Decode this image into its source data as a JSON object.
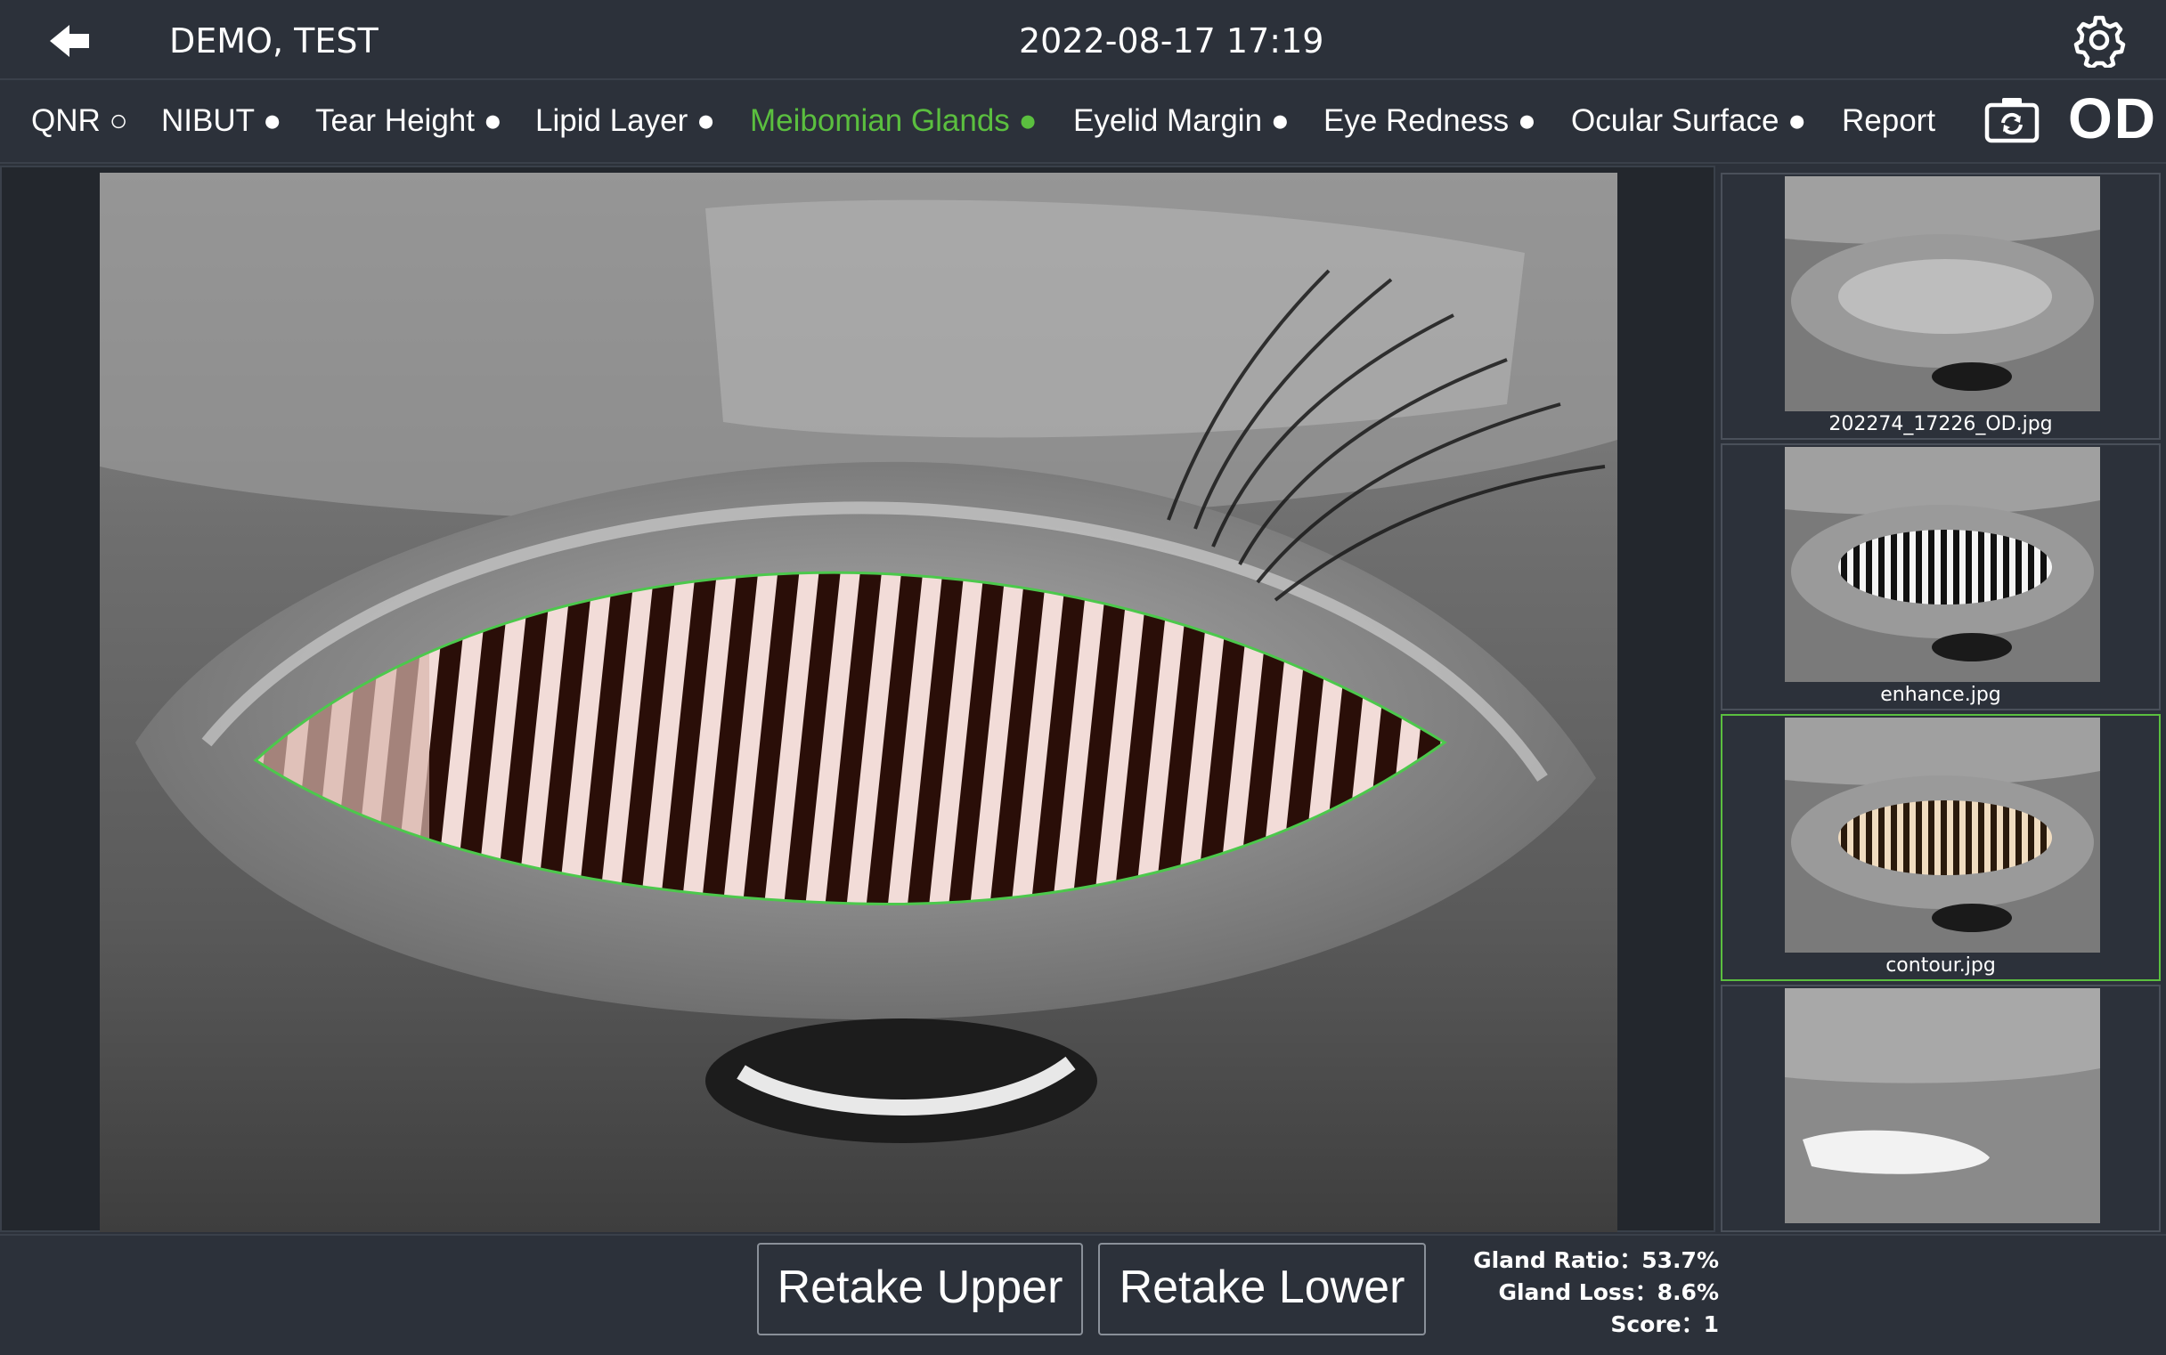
{
  "header": {
    "patient_name": "DEMO, TEST",
    "datetime": "2022-08-17 17:19"
  },
  "nav": {
    "tabs": [
      {
        "label": "QNR ○"
      },
      {
        "label": "NIBUT ●"
      },
      {
        "label": "Tear Height ●"
      },
      {
        "label": "Lipid Layer ●"
      },
      {
        "label": "Meibomian Glands ●",
        "active": true
      },
      {
        "label": "Eyelid Margin ●"
      },
      {
        "label": "Eye Redness ●"
      },
      {
        "label": "Ocular Surface ●"
      },
      {
        "label": "Report"
      }
    ],
    "eye": "OD"
  },
  "thumbnails": [
    {
      "label": "202274_17226_OD.jpg"
    },
    {
      "label": "enhance.jpg"
    },
    {
      "label": "contour.jpg",
      "selected": true
    },
    {
      "label": ""
    }
  ],
  "footer": {
    "retake_upper": "Retake Upper",
    "retake_lower": "Retake Lower",
    "gland_ratio": "Gland Ratio：53.7%",
    "gland_loss": "Gland Loss：8.6%",
    "score": "Score：1"
  },
  "colors": {
    "background": "#2c313a",
    "accent": "#5bbf3f",
    "gland_dark": "#2a0e08",
    "gland_light": "#f2dcd8",
    "contour": "#4cc84c"
  },
  "icons": {
    "back": "back-arrow-icon",
    "settings": "gear-icon",
    "camera": "camera-switch-icon"
  }
}
